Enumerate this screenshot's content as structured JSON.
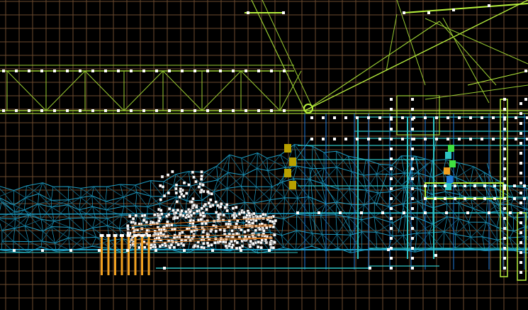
{
  "editor_view": {
    "background_color": "#000000",
    "grid_color": "#6b4a2e",
    "colors": {
      "truss": "#9acd32",
      "truss_bright": "#b8f03c",
      "terrain_mesh": "#1e9ec4",
      "terrain_mesh_dark": "#146e8c",
      "structure": "#2ec4c4",
      "structure_blue": "#1e7ad8",
      "vertex": "#ffffff",
      "highlight_orange": "#f0a020",
      "path_orange": "#e07818",
      "marker_olive": "#b8a000",
      "marker_green": "#40e040",
      "marker_blue": "#2060e0"
    },
    "icons": [
      "vertex-handle-icon",
      "waypoint-marker-icon",
      "light-source-icon"
    ]
  }
}
